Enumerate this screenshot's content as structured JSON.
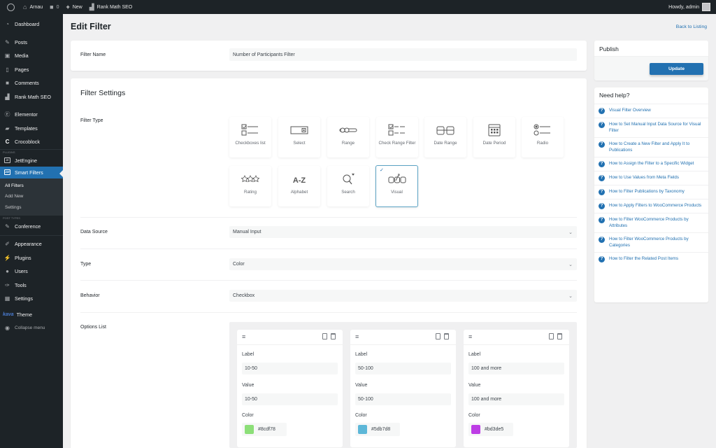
{
  "adminbar": {
    "site_name": "Arnau",
    "comments_count": "0",
    "new_label": "New",
    "rankmath_label": "Rank Math SEO",
    "greeting": "Howdy, admin"
  },
  "sidebar": {
    "items_top": [
      {
        "label": "Dashboard",
        "icon": "dashboard-icon"
      },
      {
        "label": "Posts",
        "icon": "pin-icon"
      },
      {
        "label": "Media",
        "icon": "media-icon"
      },
      {
        "label": "Pages",
        "icon": "pages-icon"
      },
      {
        "label": "Comments",
        "icon": "comment-icon"
      },
      {
        "label": "Rank Math SEO",
        "icon": "rankmath-icon"
      },
      {
        "label": "Elementor",
        "icon": "elementor-icon"
      },
      {
        "label": "Templates",
        "icon": "folder-icon"
      },
      {
        "label": "Crocoblock",
        "icon": "crocoblock-icon"
      }
    ],
    "plugins_label": "PLUGINS",
    "jetengine": "JetEngine",
    "smart_filters": "Smart Filters",
    "submenu": [
      "All Filters",
      "Add New",
      "Settings"
    ],
    "post_types_label": "POST TYPES",
    "conference": "Conference",
    "items_bottom": [
      {
        "label": "Appearance",
        "icon": "brush-icon"
      },
      {
        "label": "Plugins",
        "icon": "plugin-icon"
      },
      {
        "label": "Users",
        "icon": "user-icon"
      },
      {
        "label": "Tools",
        "icon": "wrench-icon"
      },
      {
        "label": "Settings",
        "icon": "settings-icon"
      }
    ],
    "theme_logo": "kava",
    "theme": "Theme",
    "collapse": "Collapse menu"
  },
  "page": {
    "title": "Edit Filter",
    "back_link": "Back to Listing"
  },
  "filter_name": {
    "label": "Filter Name",
    "value": "Number of Participants Filter"
  },
  "settings": {
    "title": "Filter Settings",
    "filter_type_label": "Filter Type",
    "filter_types": [
      {
        "label": "Checkboxes list",
        "icon": "checkboxes-icon",
        "selected": false
      },
      {
        "label": "Select",
        "icon": "select-icon",
        "selected": false
      },
      {
        "label": "Range",
        "icon": "range-icon",
        "selected": false
      },
      {
        "label": "Check Range Filter",
        "icon": "check-range-icon",
        "selected": false
      },
      {
        "label": "Date Range",
        "icon": "date-range-icon",
        "selected": false
      },
      {
        "label": "Date Period",
        "icon": "calendar-icon",
        "selected": false
      },
      {
        "label": "Radio",
        "icon": "radio-icon",
        "selected": false
      },
      {
        "label": "Rating",
        "icon": "stars-icon",
        "selected": false
      },
      {
        "label": "Alphabet",
        "icon": "alphabet-icon",
        "selected": false
      },
      {
        "label": "Search",
        "icon": "search-icon",
        "selected": false
      },
      {
        "label": "Visual",
        "icon": "visual-icon",
        "selected": true
      }
    ],
    "data_source": {
      "label": "Data Source",
      "value": "Manual Input"
    },
    "type": {
      "label": "Type",
      "value": "Color"
    },
    "behavior": {
      "label": "Behavior",
      "value": "Checkbox"
    },
    "options_list_label": "Options List",
    "options": [
      {
        "label_caption": "Label",
        "label": "10-50",
        "value_caption": "Value",
        "value": "10-50",
        "color_caption": "Color",
        "color": "#8cdf78"
      },
      {
        "label_caption": "Label",
        "label": "50-100",
        "value_caption": "Value",
        "value": "50-100",
        "color_caption": "Color",
        "color": "#5db7d8"
      },
      {
        "label_caption": "Label",
        "label": "100 and more",
        "value_caption": "Value",
        "value": "100 and more",
        "color_caption": "Color",
        "color": "#bd3de5"
      }
    ]
  },
  "publish": {
    "title": "Publish",
    "update_label": "Update"
  },
  "help": {
    "title": "Need help?",
    "links": [
      "Visual Filter Overview",
      "How to Set Manual Input Data Source for Visual Filter",
      "How to Create a New Filter and Apply It to Publications",
      "How to Assign the Filter to a Specific Widget",
      "How to Use Values from Meta Fields",
      "How to Filter Publications by Taxonomy",
      "How to Apply Filters to WooCommerce Products",
      "How to Filter WooCommerce Products by Attributes",
      "How to Filter WooCommerce Products by Categories",
      "How to Filter the Related Post Items"
    ]
  },
  "colors": {
    "accent": "#2271b1",
    "admin_dark": "#1d2327"
  }
}
